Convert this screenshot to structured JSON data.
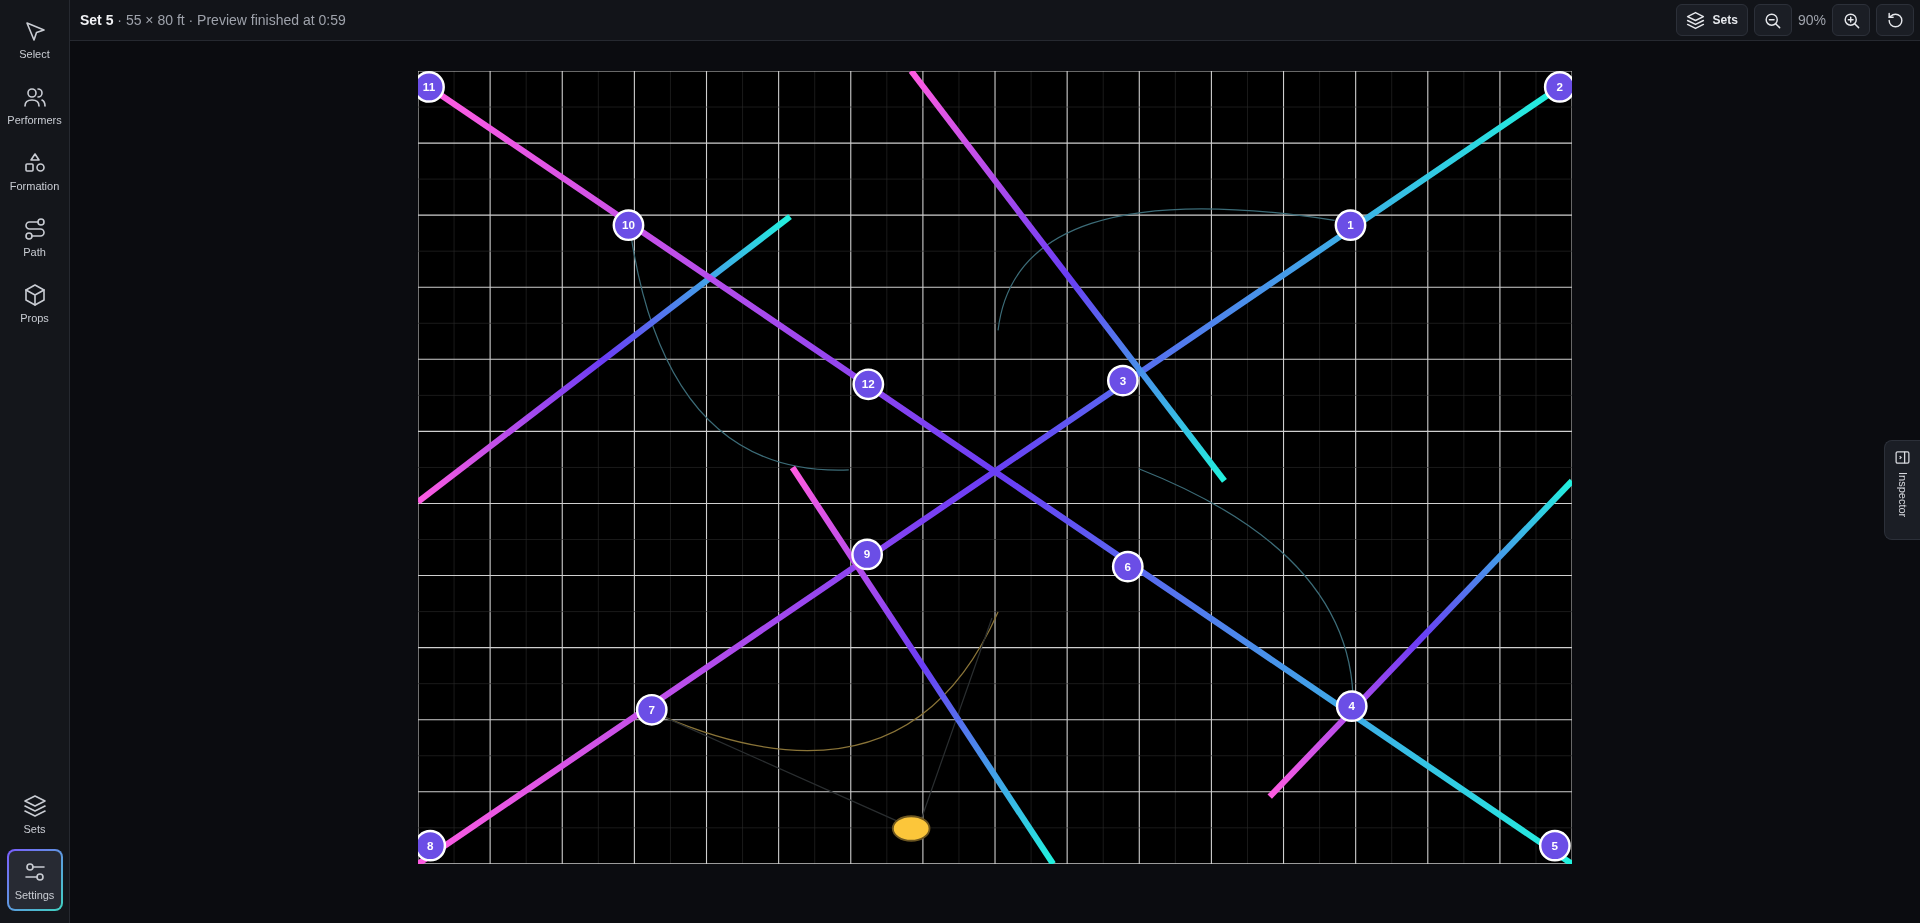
{
  "header": {
    "title": "**Set 5** · 55 × 80 ft · Preview finished at 0:59"
  },
  "tools": [
    {
      "label": "Select",
      "selected": false
    },
    {
      "label": "Performers",
      "selected": false
    },
    {
      "label": "Formation",
      "selected": false
    },
    {
      "label": "Path",
      "selected": false
    },
    {
      "label": "Props",
      "selected": false
    }
  ],
  "bottom_tools": [
    {
      "label": "Sets",
      "selected": false
    },
    {
      "label": "Settings",
      "selected": true
    }
  ],
  "toolbar": {
    "sets_button": "Sets",
    "zoom": "90%"
  },
  "inspector_tab": {
    "label": "Inspector"
  },
  "performers": [
    {
      "label": "11"
    },
    {
      "label": "2"
    },
    {
      "label": "10"
    },
    {
      "label": "1"
    },
    {
      "label": "3"
    },
    {
      "label": "12"
    },
    {
      "label": "9"
    },
    {
      "label": "6"
    },
    {
      "label": "4"
    },
    {
      "label": "7"
    },
    {
      "label": "8"
    },
    {
      "label": "5"
    }
  ]
}
